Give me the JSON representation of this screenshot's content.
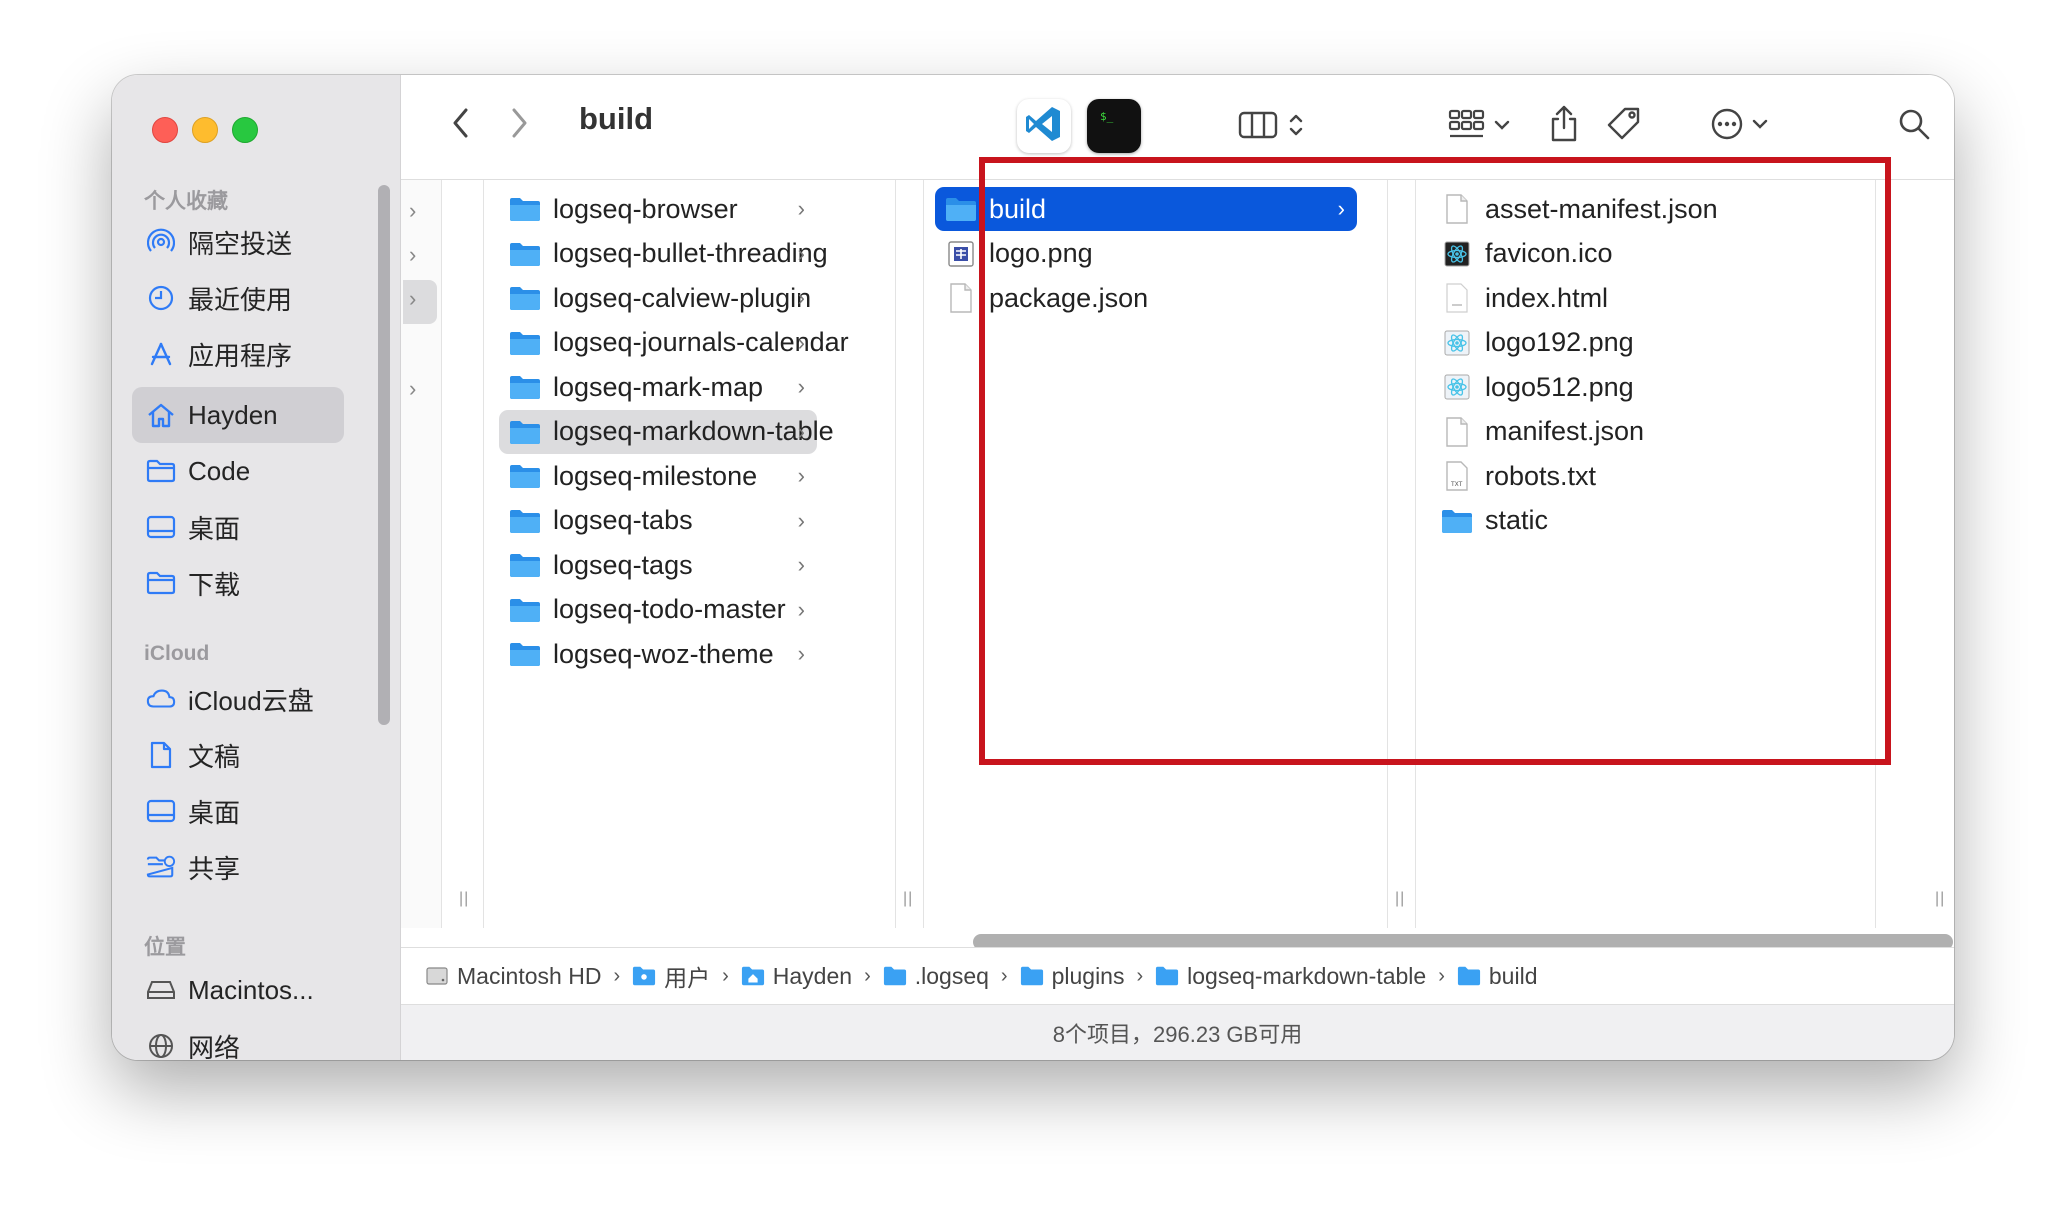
{
  "window": {
    "title": "build"
  },
  "sidebar": {
    "sections": [
      {
        "header": "个人收藏",
        "items": [
          {
            "label": "隔空投送",
            "icon": "airdrop-icon"
          },
          {
            "label": "最近使用",
            "icon": "clock-icon"
          },
          {
            "label": "应用程序",
            "icon": "applications-icon"
          },
          {
            "label": "Hayden",
            "icon": "home-icon",
            "selected": true
          },
          {
            "label": "Code",
            "icon": "folder-icon"
          },
          {
            "label": "桌面",
            "icon": "desktop-icon"
          },
          {
            "label": "下载",
            "icon": "folder-icon"
          }
        ]
      },
      {
        "header": "iCloud",
        "items": [
          {
            "label": "iCloud云盘",
            "icon": "cloud-icon"
          },
          {
            "label": "文稿",
            "icon": "document-icon"
          },
          {
            "label": "桌面",
            "icon": "desktop-icon"
          },
          {
            "label": "共享",
            "icon": "shared-folder-icon"
          }
        ]
      },
      {
        "header": "位置",
        "items": [
          {
            "label": "Macintos...",
            "icon": "disk-icon"
          },
          {
            "label": "网络",
            "icon": "globe-icon"
          }
        ]
      }
    ]
  },
  "columns": {
    "col1": [
      {
        "label": "logseq-browser"
      },
      {
        "label": "logseq-bullet-threading"
      },
      {
        "label": "logseq-calview-plugin"
      },
      {
        "label": "logseq-journals-calendar"
      },
      {
        "label": "logseq-mark-map"
      },
      {
        "label": "logseq-markdown-table",
        "selected": true
      },
      {
        "label": "logseq-milestone"
      },
      {
        "label": "logseq-tabs"
      },
      {
        "label": "logseq-tags"
      },
      {
        "label": "logseq-todo-master"
      },
      {
        "label": "logseq-woz-theme"
      }
    ],
    "col2": [
      {
        "label": "build",
        "kind": "folder",
        "selected": true
      },
      {
        "label": "logo.png",
        "kind": "image"
      },
      {
        "label": "package.json",
        "kind": "file"
      }
    ],
    "col3": [
      {
        "label": "asset-manifest.json",
        "kind": "file"
      },
      {
        "label": "favicon.ico",
        "kind": "react-dark"
      },
      {
        "label": "index.html",
        "kind": "html"
      },
      {
        "label": "logo192.png",
        "kind": "react"
      },
      {
        "label": "logo512.png",
        "kind": "react"
      },
      {
        "label": "manifest.json",
        "kind": "file"
      },
      {
        "label": "robots.txt",
        "kind": "txt"
      },
      {
        "label": "static",
        "kind": "folder"
      }
    ]
  },
  "pathbar": [
    {
      "label": "Macintosh HD",
      "icon": "disk-icon"
    },
    {
      "label": "用户",
      "icon": "users-folder-icon"
    },
    {
      "label": "Hayden",
      "icon": "home-folder-icon"
    },
    {
      "label": ".logseq",
      "icon": "folder-icon"
    },
    {
      "label": "plugins",
      "icon": "folder-icon"
    },
    {
      "label": "logseq-markdown-table",
      "icon": "folder-icon"
    },
    {
      "label": "build",
      "icon": "folder-icon"
    }
  ],
  "status": {
    "text": "8个项目，296.23 GB可用"
  },
  "colors": {
    "accent": "#0a58dc",
    "highlight": "#c8141d",
    "folder": "#3aa1f3"
  }
}
